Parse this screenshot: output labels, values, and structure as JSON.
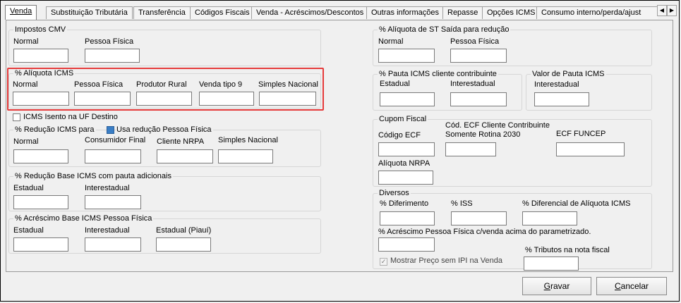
{
  "tabs": [
    "Venda",
    "Substituição Tributária",
    "Transferência",
    "Códigos Fiscais",
    "Venda - Acréscimos/Descontos",
    "Outras informações",
    "Repasse",
    "Opções ICMS",
    "Consumo interno/perda/ajust"
  ],
  "scroll": {
    "left": "◀",
    "right": "▶"
  },
  "impostos_cmv": {
    "title": "Impostos CMV",
    "normal": "Normal",
    "pessoa_fisica": "Pessoa Física"
  },
  "aliquota_icms": {
    "title": "% Alíquota ICMS",
    "normal": "Normal",
    "pessoa_fisica": "Pessoa Física",
    "produtor_rural": "Produtor Rural",
    "venda_tipo9": "Venda tipo 9",
    "simples_nacional": "Simples Nacional"
  },
  "icms_isento": "ICMS Isento na UF Destino",
  "reducao_icms": {
    "title": "% Redução ICMS para",
    "usa_reducao": "Usa redução Pessoa Física",
    "normal": "Normal",
    "consumidor_final": "Consumidor Final",
    "cliente_nrpa": "Cliente NRPA",
    "simples_nacional": "Simples Nacional"
  },
  "reducao_base": {
    "title": "% Redução Base ICMS com pauta adicionais",
    "estadual": "Estadual",
    "interestadual": "Interestadual"
  },
  "acrescimo_base": {
    "title": "% Acréscimo Base ICMS Pessoa Física",
    "estadual": "Estadual",
    "interestadual": "Interestadual",
    "estadual_piaui": "Estadual (Piauí)"
  },
  "aliquota_st": {
    "title": "% Alíquota de ST Saída para redução",
    "normal": "Normal",
    "pessoa_fisica": "Pessoa Física"
  },
  "pauta_icms": {
    "title": "% Pauta ICMS cliente contribuinte",
    "estadual": "Estadual",
    "interestadual": "Interestadual"
  },
  "valor_pauta": {
    "title": "Valor de Pauta ICMS",
    "interestadual": "Interestadual"
  },
  "cupom_fiscal": {
    "title": "Cupom Fiscal",
    "codigo_ecf": "Código ECF",
    "cod_ecf_cliente_1": "Cód. ECF Cliente Contribuinte",
    "cod_ecf_cliente_2": "Somente Rotina 2030",
    "ecf_funcep": "ECF FUNCEP",
    "aliquota_nrpa": "Alíquota NRPA"
  },
  "diversos": {
    "title": "Diversos",
    "diferimento": "% Diferimento",
    "iss": "% ISS",
    "diferencial": "% Diferencial de Alíquota ICMS",
    "acrescimo_pf": "% Acréscimo Pessoa Física c/venda acima do parametrizado.",
    "tributos": "% Tributos na nota fiscal",
    "mostrar_preco": "Mostrar Preço sem IPI na Venda"
  },
  "buttons": {
    "gravar_u": "G",
    "gravar_rest": "ravar",
    "cancelar_u": "C",
    "cancelar_rest": "ancelar"
  }
}
